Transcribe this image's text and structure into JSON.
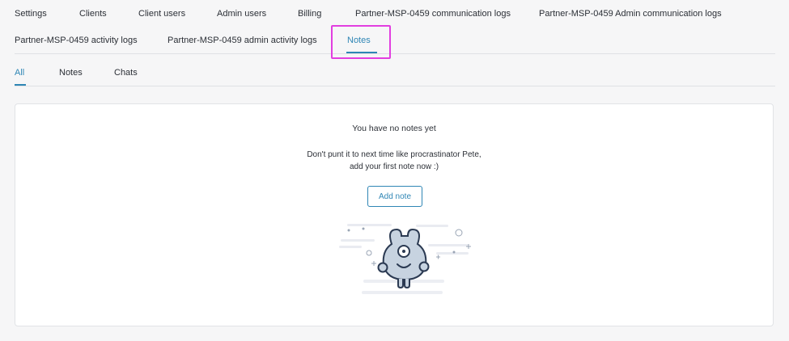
{
  "top_tabs": [
    {
      "label": "Settings"
    },
    {
      "label": "Clients"
    },
    {
      "label": "Client users"
    },
    {
      "label": "Admin users"
    },
    {
      "label": "Billing"
    },
    {
      "label": "Partner-MSP-0459 communication logs"
    },
    {
      "label": "Partner-MSP-0459 Admin communication logs"
    },
    {
      "label": "Partner-MSP-0459 activity logs"
    },
    {
      "label": "Partner-MSP-0459 admin activity logs"
    },
    {
      "label": "Notes"
    }
  ],
  "sub_tabs": [
    {
      "label": "All"
    },
    {
      "label": "Notes"
    },
    {
      "label": "Chats"
    }
  ],
  "empty_state": {
    "title": "You have no notes yet",
    "line1": "Don't punt it to next time like procrastinator Pete,",
    "line2": "add your first note now :)",
    "button": "Add note"
  },
  "colors": {
    "accent": "#2f86b5",
    "highlight": "#e23ee0",
    "background": "#f6f6f7"
  }
}
